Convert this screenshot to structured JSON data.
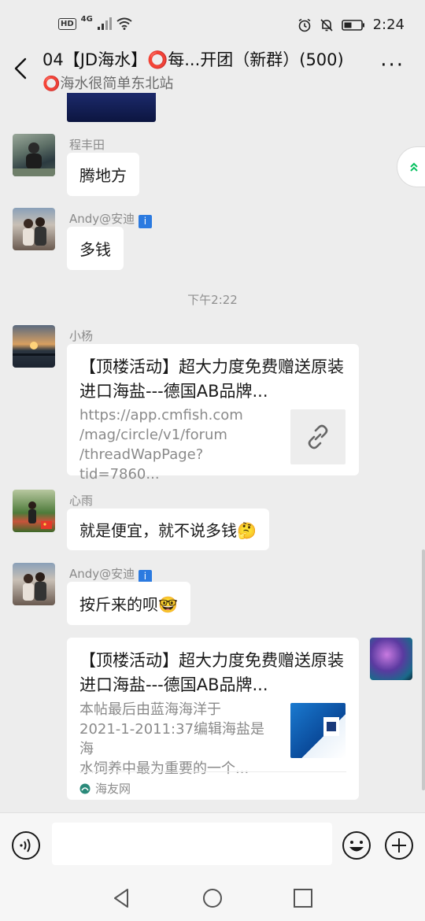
{
  "status_bar": {
    "left_badge": "HD",
    "network": "4G",
    "time": "2:24"
  },
  "header": {
    "title": "04【JD海水】⭕每...开团（新群）(500)",
    "subtitle": "⭕海水很简单东北站",
    "more_label": "···"
  },
  "messages": [
    {
      "sender": "程丰田",
      "text": "腾地方"
    },
    {
      "sender": "Andy@安迪",
      "text": "多钱"
    },
    {
      "timestamp": "下午2:22"
    },
    {
      "sender": "小杨",
      "card": {
        "title": "【顶楼活动】超大力度免费赠送原装进口海盐---德国AB品牌...",
        "desc_lines": [
          "https://app.cmfish.com",
          "/mag/circle/v1/forum",
          "/threadWapPage?tid=7860..."
        ]
      }
    },
    {
      "sender": "心雨",
      "text": "就是便宜，就不说多钱🤔"
    },
    {
      "sender": "Andy@安迪",
      "text": "按斤来的呗🤓"
    },
    {
      "self": true,
      "card": {
        "title": "【顶楼活动】超大力度免费赠送原装进口海盐---德国AB品牌...",
        "desc_lines": [
          "本帖最后由蓝海海洋于",
          "2021-1-2011:37编辑海盐是海",
          "水饲养中最为重要的一个..."
        ],
        "source": "海友网"
      }
    }
  ],
  "colors": {
    "background": "#ededed",
    "bubble": "#ffffff",
    "accent_green": "#07c160"
  }
}
